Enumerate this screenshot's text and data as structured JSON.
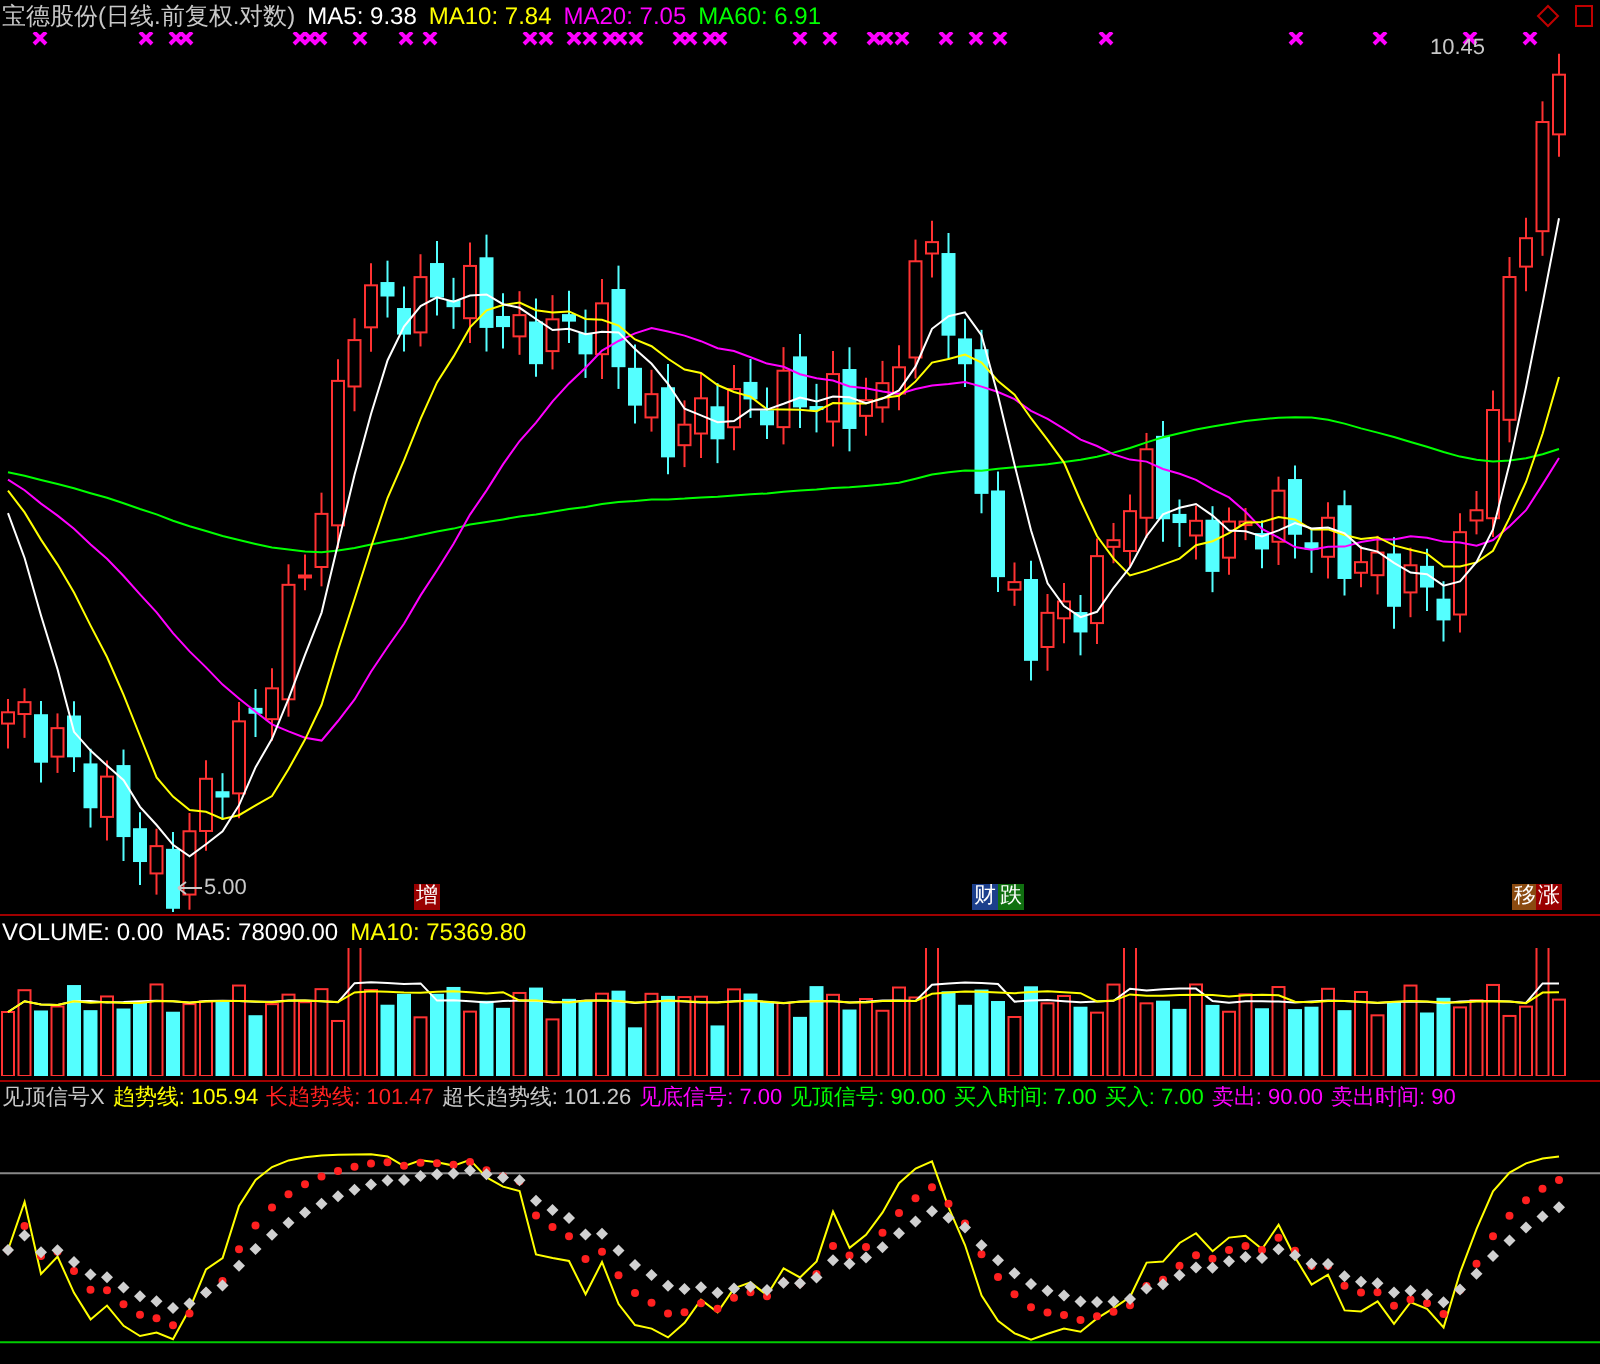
{
  "title": "宝德股份(日线.前复权.对数)",
  "moving_averages": [
    {
      "text": "MA5: 9.38",
      "color": "#ffffff"
    },
    {
      "text": "MA10: 7.84",
      "color": "#ffff00"
    },
    {
      "text": "MA20: 7.05",
      "color": "#ff00ff"
    },
    {
      "text": "MA60: 6.91",
      "color": "#00ff00"
    }
  ],
  "price_labels": {
    "high": "10.45",
    "low": "5.00"
  },
  "event_tags": [
    {
      "text": "增",
      "color": "#990000"
    },
    {
      "text": "财",
      "color": "#1c3f8c"
    },
    {
      "text": "跌",
      "color": "#107010"
    },
    {
      "text": "移",
      "color": "#8a4a10"
    },
    {
      "text": "涨",
      "color": "#990000"
    }
  ],
  "volume": [
    {
      "text": "VOLUME: 0.00",
      "color": "#ffffff"
    },
    {
      "text": "MA5: 78090.00",
      "color": "#ffffff"
    },
    {
      "text": "MA10: 75369.80",
      "color": "#ffff00"
    }
  ],
  "indicator": [
    {
      "text": "见顶信号X",
      "color": "#c8c8c8"
    },
    {
      "text": "趋势线: 105.94",
      "color": "#ffff00"
    },
    {
      "text": "长趋势线: 101.47",
      "color": "#ff2020"
    },
    {
      "text": "超长趋势线: 101.26",
      "color": "#c8c8c8"
    },
    {
      "text": "见底信号: 7.00",
      "color": "#ff00ff"
    },
    {
      "text": "见顶信号: 90.00",
      "color": "#00ff00"
    },
    {
      "text": "买入时间: 7.00",
      "color": "#00ff00"
    },
    {
      "text": "买入: 7.00",
      "color": "#00ff00"
    },
    {
      "text": "卖出: 90.00",
      "color": "#ff00ff"
    },
    {
      "text": "卖出时间: 90",
      "color": "#ff00ff"
    }
  ]
}
